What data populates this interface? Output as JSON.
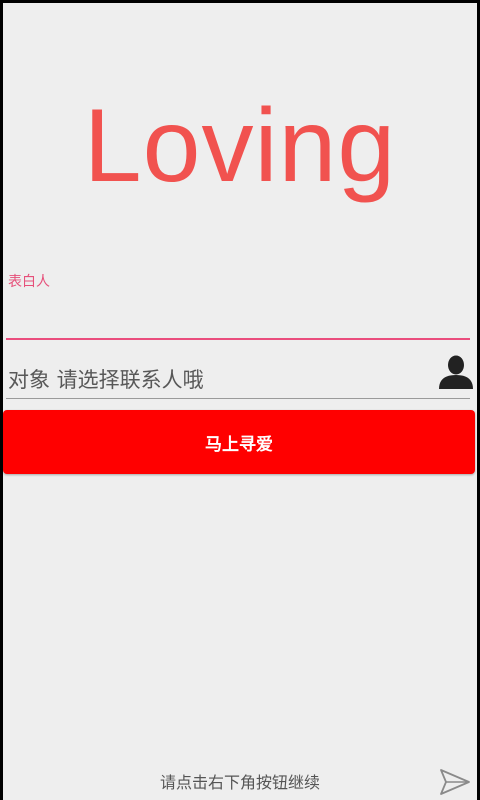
{
  "app": {
    "title": "Loving"
  },
  "form": {
    "confessor_label": "表白人",
    "confessor_value": "",
    "target_placeholder": "对象 请选择联系人哦",
    "target_value": "",
    "submit_label": "马上寻爱"
  },
  "footer": {
    "hint": "请点击右下角按钮继续"
  },
  "icons": {
    "contact": "person-silhouette-icon",
    "send": "send-paper-plane-icon"
  },
  "colors": {
    "title": "#f1524f",
    "accent": "#ea4d7d",
    "button": "#ff0000",
    "background": "#eeeeee"
  }
}
